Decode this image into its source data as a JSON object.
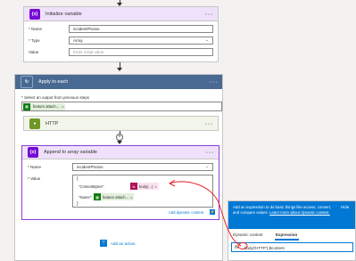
{
  "init_var": {
    "title": "Initialize variable",
    "icon_text": "{x}",
    "name_label": "* Name",
    "name_value": "incidentPhotos",
    "type_label": "* Type",
    "type_value": "Array",
    "value_label": "Value",
    "value_placeholder": "Enter initial value",
    "more": "···"
  },
  "apply_each": {
    "title": "Apply to each",
    "select_label": "* Select an output from previous steps",
    "token_label": "feature attach...",
    "more": "···"
  },
  "http": {
    "title": "HTTP",
    "more": "···"
  },
  "append": {
    "title": "Append to array variable",
    "icon_text": "{x}",
    "name_label": "* Name",
    "name_value": "incidentPhotos",
    "value_label": "* Value",
    "brace_open": "{",
    "brace_close": "}",
    "content_bytes_key": "\"ContentBytes\":",
    "name_key": "\"Name\":",
    "body_token": "body(...)",
    "feature_token": "feature attach...",
    "add_dynamic": "Add dynamic content",
    "more": "···"
  },
  "add_action": "Add an action",
  "panel": {
    "info": "Add an expression to do basic things like access, convert, and compare values.",
    "learn_more": "Learn more about dynamic content.",
    "hide": "Hide",
    "tab_dynamic": "Dynamic content",
    "tab_expression": "Expression",
    "fx": "fx",
    "expression": "body('HTTP').$content"
  },
  "colors": {
    "variable_purple": "#770bd6",
    "loop_blue": "#486991",
    "http_green": "#709727",
    "panel_blue": "#0078d4",
    "annotation_red": "#e8202a"
  }
}
